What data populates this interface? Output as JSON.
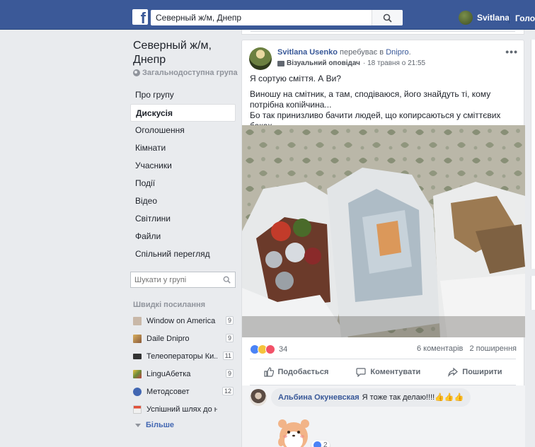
{
  "topbar": {
    "logo": "f",
    "search_value": "Северный ж/м, Днепр",
    "user_name": "Svitlana",
    "home_label": "Голов"
  },
  "group": {
    "title": "Северный ж/м, Днепр",
    "privacy": "Загальнодоступна група"
  },
  "nav": {
    "items": [
      {
        "label": "Про групу"
      },
      {
        "label": "Дискусія",
        "active": true
      },
      {
        "label": "Оголошення"
      },
      {
        "label": "Кімнати"
      },
      {
        "label": "Учасники"
      },
      {
        "label": "Події"
      },
      {
        "label": "Відео"
      },
      {
        "label": "Світлини"
      },
      {
        "label": "Файли"
      },
      {
        "label": "Спільний перегляд"
      }
    ]
  },
  "group_search": {
    "placeholder": "Шукати у групі"
  },
  "shortcuts": {
    "title": "Швидкі посилання",
    "items": [
      {
        "label": "Window on America ...",
        "count": "9",
        "icon": "window-icon",
        "color": "#c9b8a8"
      },
      {
        "label": "Daile Dnipro",
        "count": "9",
        "icon": "group-photo-icon",
        "color": "#8a5a3a"
      },
      {
        "label": "Телеоператоры Ки...",
        "count": "11",
        "icon": "camera-icon",
        "color": "#333333"
      },
      {
        "label": "LinguAбетка",
        "count": "9",
        "icon": "lingua-icon",
        "color": "#6a8a3a"
      },
      {
        "label": "Методсовет",
        "count": "12",
        "icon": "people-icon",
        "color": "#4267b2"
      },
      {
        "label": "Успішний шлях до нав...",
        "count": "",
        "icon": "calendar-icon",
        "color": "#e0503a"
      }
    ],
    "more_label": "Більше"
  },
  "post": {
    "author": "Svitlana Usenko",
    "action_text": " перебуває в ",
    "location": "Dnipro",
    "location_suffix": ".",
    "badge": "Візуальний оповідач",
    "date": "18 травня о 21:55",
    "text_lines": [
      "Я сортую сміття. А Ви?",
      "Виношу на смітник, а там, сподіваюся, його знайдуть ті, кому потрібна копійчина...",
      "Бо так принизливо бачити людей, що копирсаються у сміттєвих баках."
    ],
    "reaction_count": "34",
    "comments": "6 коментарів",
    "shares": "2 поширення",
    "actions": {
      "like": "Подобається",
      "comment": "Коментувати",
      "share": "Поширити"
    }
  },
  "comment": {
    "author": "Альбина Окуневская",
    "text": "Я тоже так делаю!!!!👍👍👍",
    "reaction_count": "2"
  },
  "colors": {
    "brand": "#3b5998",
    "link": "#385898",
    "background": "#e9ebee"
  }
}
